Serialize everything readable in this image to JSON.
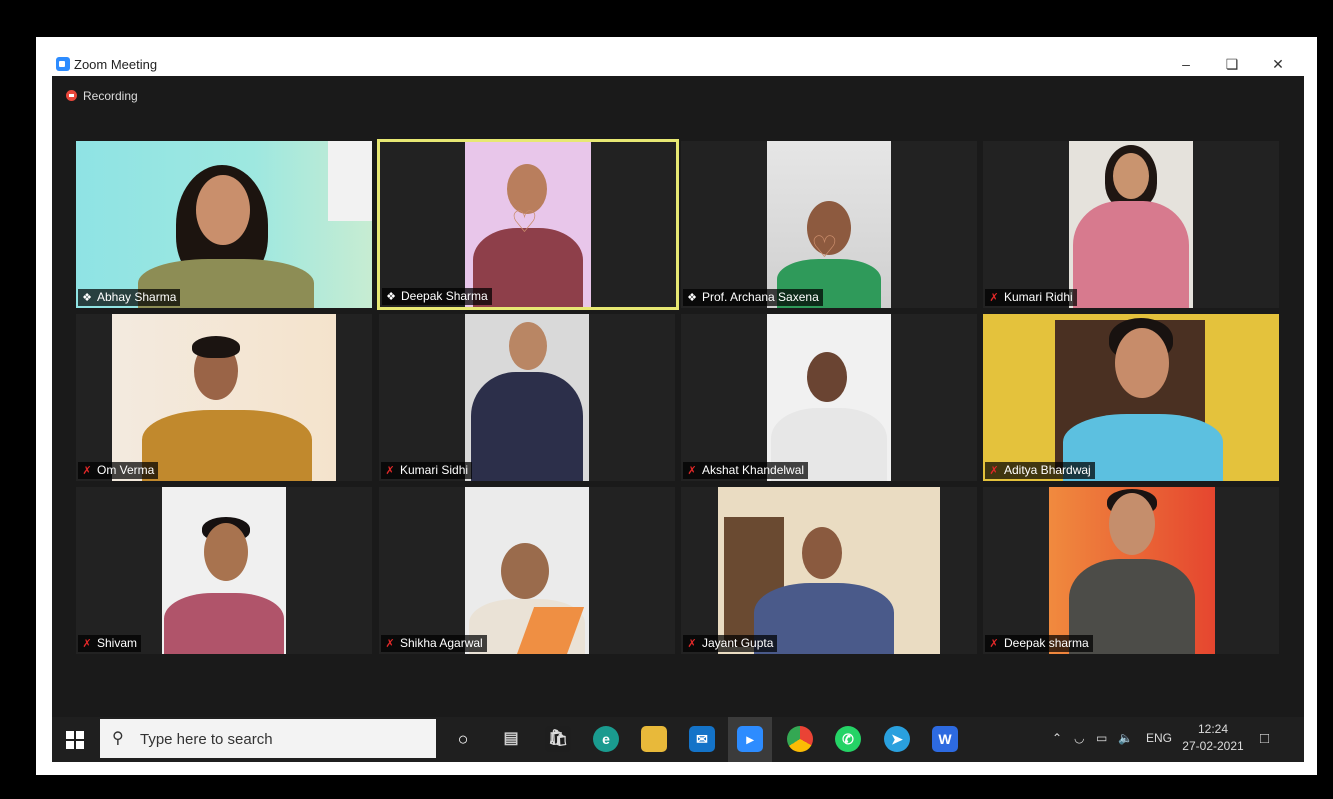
{
  "window": {
    "title": "Zoom Meeting",
    "recording_label": "Recording"
  },
  "participants": [
    {
      "name": "Abhay Sharma",
      "status": "pinned"
    },
    {
      "name": "Deepak Sharma",
      "status": "pinned",
      "active_speaker": true
    },
    {
      "name": "Prof. Archana Saxena",
      "status": "pinned"
    },
    {
      "name": "Kumari Ridhi",
      "status": "muted"
    },
    {
      "name": "Om Verma",
      "status": "muted"
    },
    {
      "name": "Kumari Sidhi",
      "status": "muted"
    },
    {
      "name": "Akshat Khandelwal",
      "status": "muted"
    },
    {
      "name": "Aditya Bhardwaj",
      "status": "muted"
    },
    {
      "name": "Shivam",
      "status": "muted"
    },
    {
      "name": "Shikha Agarwal",
      "status": "muted"
    },
    {
      "name": "Jayant Gupta",
      "status": "muted"
    },
    {
      "name": "Deepak sharma",
      "status": "muted"
    }
  ],
  "taskbar": {
    "search_placeholder": "Type here to search",
    "apps": [
      "cortana-icon",
      "task-view-icon",
      "store-icon",
      "edge-icon",
      "file-explorer-icon",
      "mail-icon",
      "zoom-icon",
      "chrome-icon",
      "whatsapp-icon",
      "telegram-icon",
      "wps-office-icon"
    ],
    "active_app": "zoom-icon",
    "language": "ENG",
    "time": "12:24",
    "date": "27-02-2021"
  },
  "colors": {
    "active_speaker_border": "#e7e873",
    "mic_muted": "#e02828",
    "zoom_blue": "#2d8cff"
  }
}
